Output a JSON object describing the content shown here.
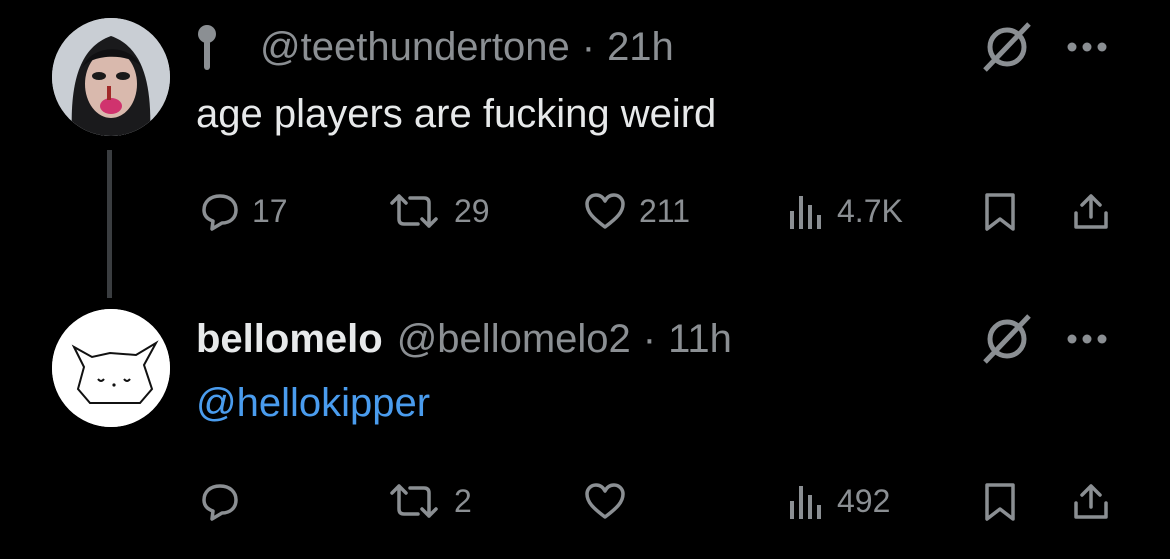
{
  "tweet1": {
    "handle": "@teethundertone",
    "sep": "·",
    "time": "21h",
    "text": "age players are fucking weird",
    "stats": {
      "replies": "17",
      "reposts": "29",
      "likes": "211",
      "views": "4.7K"
    }
  },
  "tweet2": {
    "name": "bellomelo",
    "handle": "@bellomelo2",
    "sep": "·",
    "time": "11h",
    "text": "@hellokipper",
    "stats": {
      "replies": "",
      "reposts": "2",
      "likes": "",
      "views": "492"
    }
  },
  "colors": {
    "background": "#000000",
    "text": "#e7e9ea",
    "muted": "#8b8f93",
    "mention": "#4a9cee",
    "thread_line": "#3a3d40"
  },
  "icons": [
    "pin-emoji-icon",
    "grok-icon",
    "more-icon",
    "reply-icon",
    "repost-icon",
    "like-icon",
    "views-icon",
    "bookmark-icon",
    "share-icon"
  ]
}
